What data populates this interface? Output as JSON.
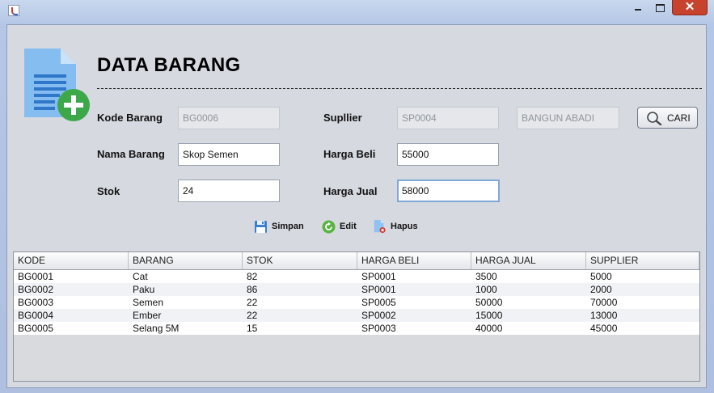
{
  "window": {
    "title": ""
  },
  "form": {
    "title": "DATA BARANG",
    "labels": {
      "kode": "Kode Barang",
      "nama": "Nama Barang",
      "stok": "Stok",
      "supplier": "Supllier",
      "harga_beli": "Harga Beli",
      "harga_jual": "Harga Jual"
    },
    "values": {
      "kode": "BG0006",
      "nama": "Skop Semen",
      "stok": "24",
      "supplier_code": "SP0004",
      "supplier_name": "BANGUN ABADI",
      "harga_beli": "55000",
      "harga_jual": "58000"
    },
    "cari_label": "CARI"
  },
  "actions": {
    "simpan": "Simpan",
    "edit": "Edit",
    "hapus": "Hapus"
  },
  "table": {
    "columns": [
      "KODE",
      "BARANG",
      "STOK",
      "HARGA BELI",
      "HARGA JUAL",
      "SUPPLIER"
    ],
    "rows": [
      [
        "BG0001",
        "Cat",
        "82",
        "SP0001",
        "3500",
        "5000"
      ],
      [
        "BG0002",
        "Paku",
        "86",
        "SP0001",
        "1000",
        "2000"
      ],
      [
        "BG0003",
        "Semen",
        "22",
        "SP0005",
        "50000",
        "70000"
      ],
      [
        "BG0004",
        "Ember",
        "22",
        "SP0002",
        "15000",
        "13000"
      ],
      [
        "BG0005",
        "Selang 5M",
        "15",
        "SP0003",
        "40000",
        "45000"
      ]
    ]
  },
  "colors": {
    "accent_green": "#3da84a",
    "doc_blue": "#7fb9f0",
    "focus_border": "#7fa8d6"
  }
}
